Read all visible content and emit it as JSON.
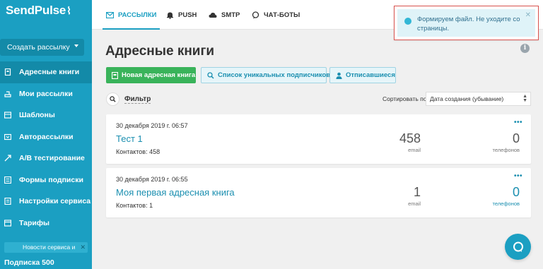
{
  "app": {
    "logo": "SendPulse",
    "brand_color": "#1b9fc2"
  },
  "sidebar": {
    "create_button": "Создать рассылку",
    "items": [
      {
        "label": "Адресные книги",
        "icon": "address-book-icon",
        "active": true
      },
      {
        "label": "Мои рассылки",
        "icon": "mailings-icon",
        "active": false
      },
      {
        "label": "Шаблоны",
        "icon": "templates-icon",
        "active": false
      },
      {
        "label": "Авторассылки",
        "icon": "autoresponder-icon",
        "active": false
      },
      {
        "label": "A/B тестирование",
        "icon": "ab-test-icon",
        "active": false
      },
      {
        "label": "Формы подписки",
        "icon": "forms-icon",
        "active": false
      },
      {
        "label": "Настройки сервиса",
        "icon": "settings-icon",
        "active": false
      },
      {
        "label": "Тарифы",
        "icon": "pricing-icon",
        "active": false
      }
    ],
    "news": "Новости сервиса и",
    "subscription": "Подписка 500"
  },
  "topnav": {
    "tabs": [
      {
        "label": "РАССЫЛКИ",
        "icon": "email-icon",
        "active": true
      },
      {
        "label": "PUSH",
        "icon": "bell-icon",
        "active": false
      },
      {
        "label": "SMTP",
        "icon": "cloud-icon",
        "active": false
      },
      {
        "label": "ЧАТ-БОТЫ",
        "icon": "chat-bubble-icon",
        "active": false
      }
    ]
  },
  "notification": {
    "text": "Формируем файл. Не уходите со страницы."
  },
  "main": {
    "title": "Адресные книги",
    "buttons": {
      "new_book": "Новая адресная книга",
      "unique": "Список уникальных подписчиков",
      "unsubscribed": "Отписавшиеся"
    },
    "filter_label": "Фильтр",
    "sort_label": "Сортировать по",
    "sort_value": "Дата создания (убывание)",
    "books": [
      {
        "date": "30 декабря 2019 г. 06:57",
        "name": "Тест 1",
        "contacts": "Контактов: 458",
        "email_count": "458",
        "email_label": "email",
        "phone_count": "0",
        "phone_label": "телефонов"
      },
      {
        "date": "30 декабря 2019 г. 06:55",
        "name": "Моя первая адресная книга",
        "contacts": "Контактов: 1",
        "email_count": "1",
        "email_label": "email",
        "phone_count": "0",
        "phone_label": "телефонов"
      }
    ]
  }
}
